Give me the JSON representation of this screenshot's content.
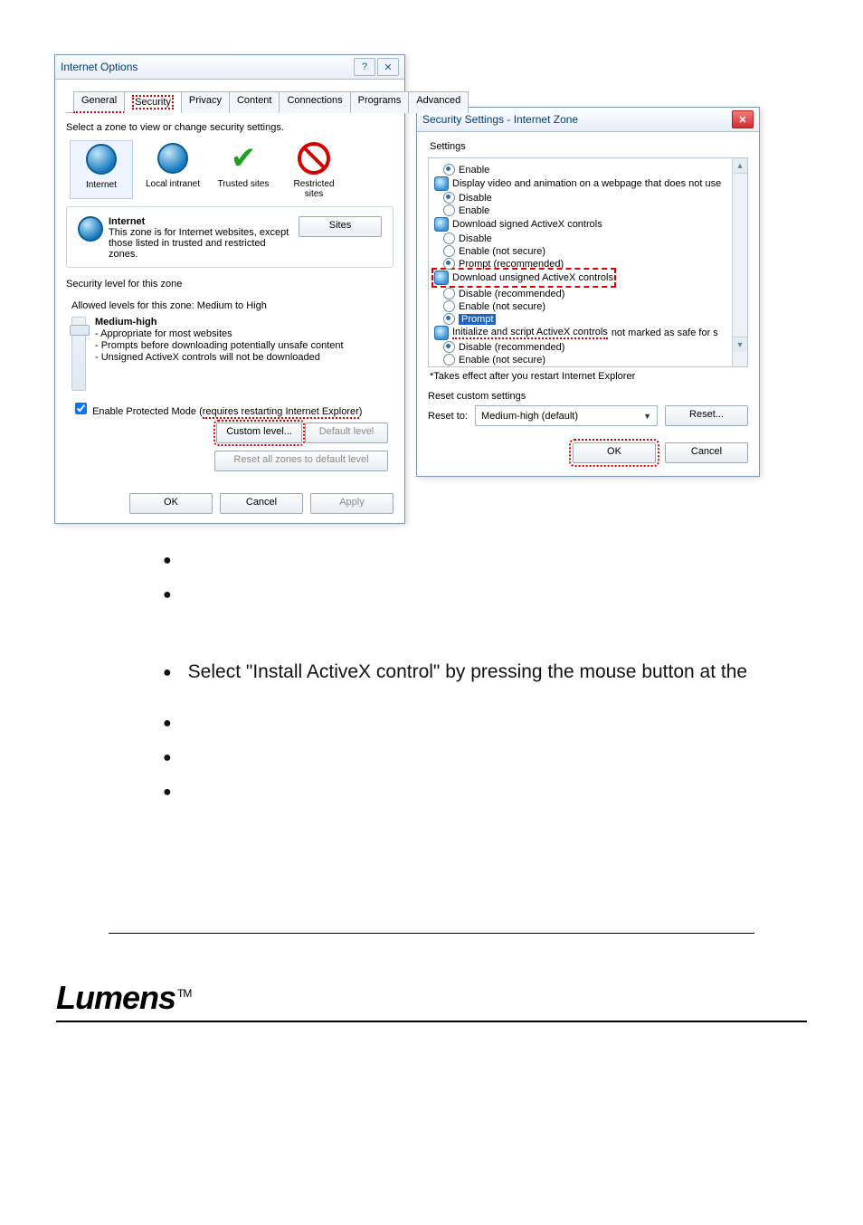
{
  "io": {
    "title": "Internet Options",
    "help_glyph": "?",
    "close_glyph": "✕",
    "tabs": {
      "general": "General",
      "security": "Security",
      "privacy": "Privacy",
      "content": "Content",
      "connections": "Connections",
      "programs": "Programs",
      "advanced": "Advanced"
    },
    "select_zone": "Select a zone to view or change security settings.",
    "zones": {
      "internet": "Internet",
      "local": "Local intranet",
      "trusted": "Trusted sites",
      "restricted": "Restricted\nsites"
    },
    "sites_btn": "Sites",
    "zone_name": "Internet",
    "zone_desc": "This zone is for Internet websites, except those listed in trusted and restricted zones.",
    "sec_level_hdr": "Security level for this zone",
    "allowed": "Allowed levels for this zone: Medium to High",
    "level_name": "Medium-high",
    "lvl1": "- Appropriate for most websites",
    "lvl2": "- Prompts before downloading potentially unsafe content",
    "lvl3": "- Unsigned ActiveX controls will not be downloaded",
    "pm_a": "Enable Protected Mode (",
    "pm_b": "requires restarting Internet Explorer",
    "pm_c": ")",
    "custom_btn": "Custom level...",
    "default_btn": "Default level",
    "reset_all": "Reset all zones to default level",
    "ok": "OK",
    "cancel": "Cancel",
    "apply": "Apply"
  },
  "ss": {
    "title": "Security Settings - Internet Zone",
    "close_glyph": "✕",
    "settings": "Settings",
    "opts": {
      "enable_top": "Enable",
      "display_video": "Display video and animation on a webpage that does not use",
      "disable": "Disable",
      "enable": "Enable",
      "dl_signed": "Download signed ActiveX controls",
      "enable_ns": "Enable (not secure)",
      "prompt_rec": "Prompt (recommended)",
      "dl_unsigned": "Download unsigned ActiveX controls",
      "disable_rec": "Disable (recommended)",
      "prompt": "Prompt",
      "init_script": "Initialize and script ActiveX controls",
      "init_tail": " not marked as safe for s",
      "prompt_cut": "Prompt"
    },
    "note": "*Takes effect after you restart Internet Explorer",
    "reset_hdr": "Reset custom settings",
    "reset_to": "Reset to:",
    "combo": "Medium-high (default)",
    "reset_btn": "Reset...",
    "ok": "OK",
    "cancel": "Cancel"
  },
  "body": {
    "instr": "Select \"Install ActiveX control\" by pressing the mouse button at the"
  },
  "logo": {
    "brand": "Lumens",
    "tm": "TM"
  }
}
